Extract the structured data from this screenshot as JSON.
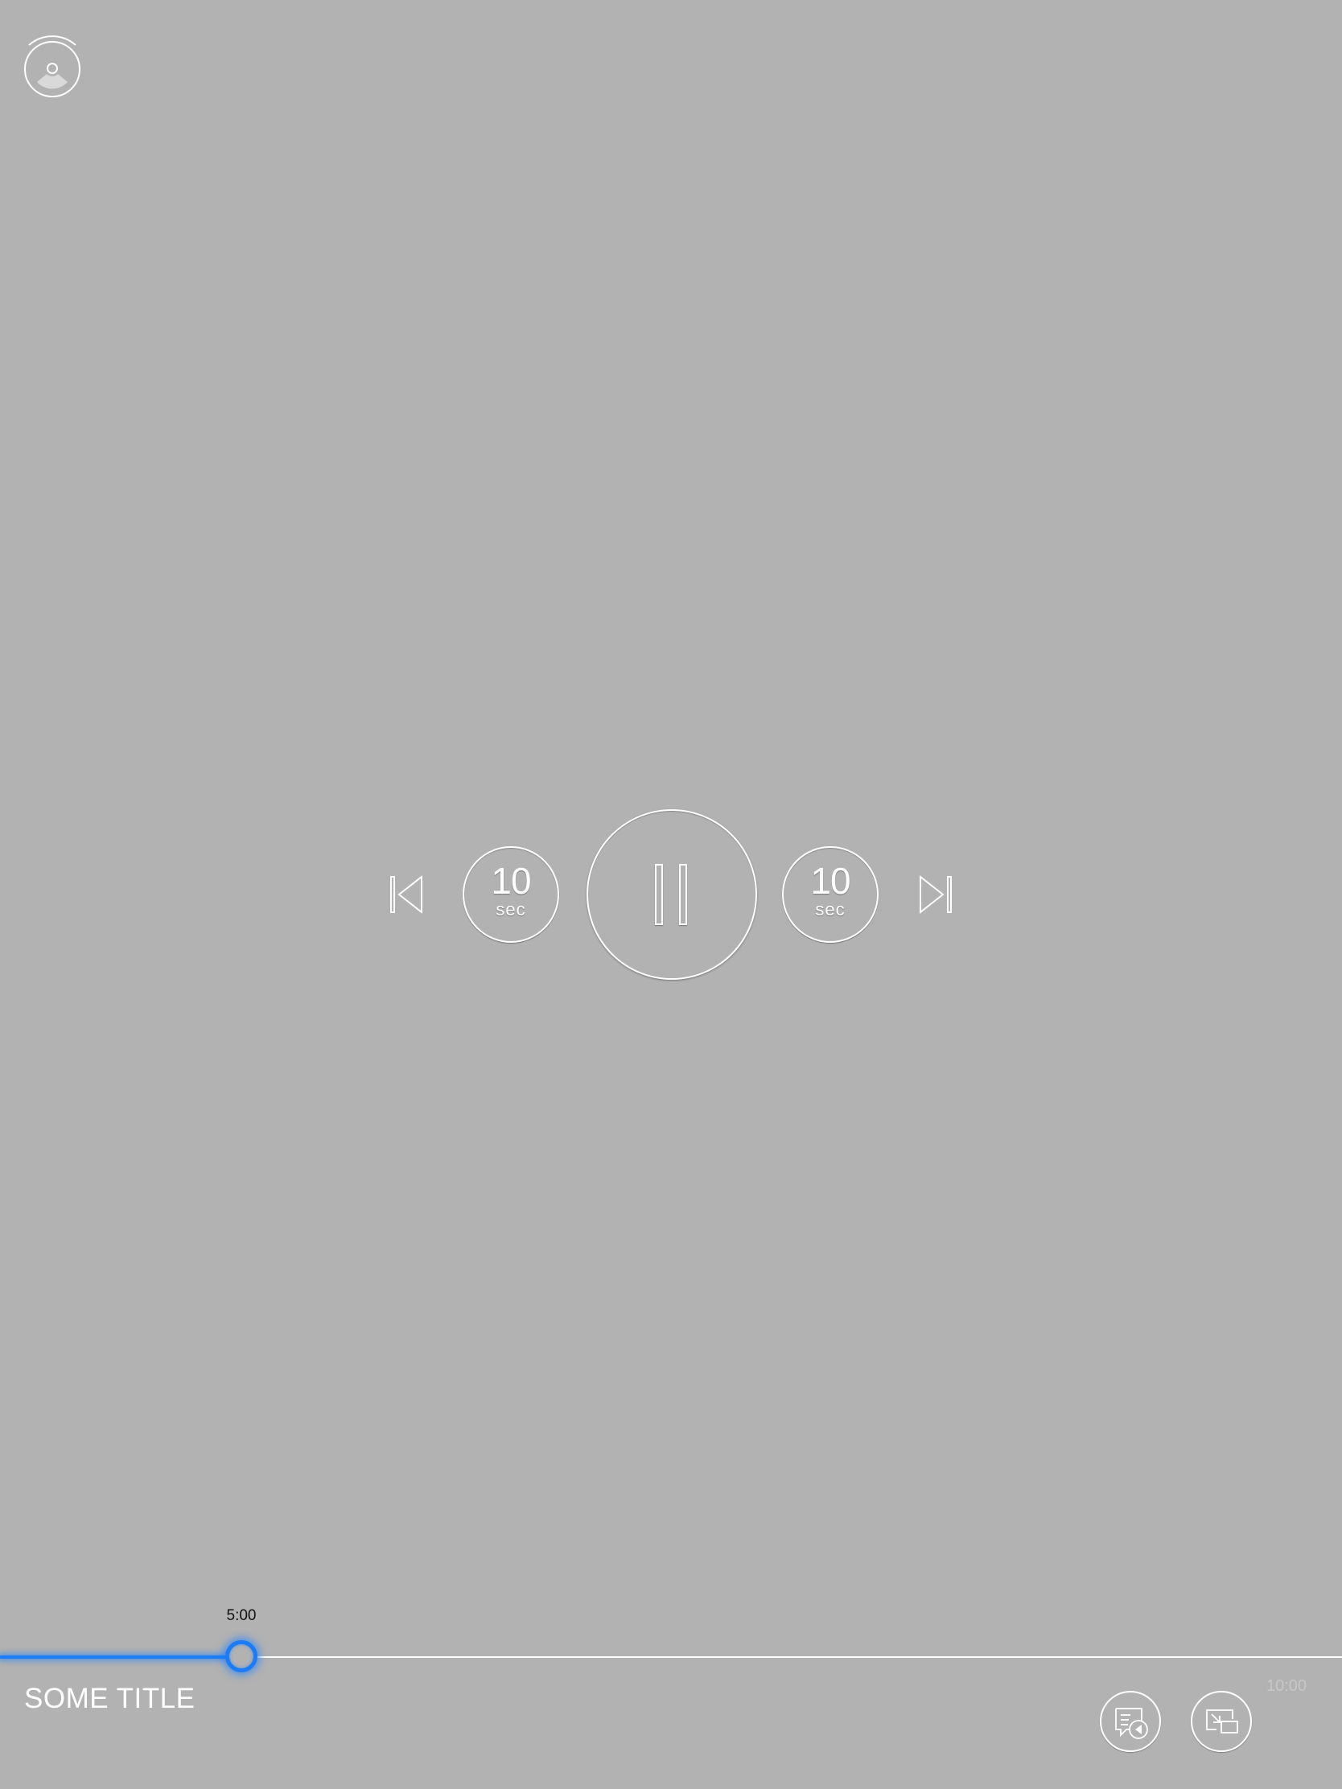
{
  "player": {
    "title": "SOME TITLE",
    "current_time": "5:00",
    "total_time": "10:00",
    "progress": 0.18
  },
  "controls": {
    "skip_back": {
      "amount": "10",
      "unit": "sec"
    },
    "skip_forward": {
      "amount": "10",
      "unit": "sec"
    }
  },
  "icons": {
    "airplay": "airplay-icon",
    "previous": "previous-track-icon",
    "pause": "pause-icon",
    "next": "next-track-icon",
    "audio_subtitles": "audio-subtitles-icon",
    "picture_in_picture": "picture-in-picture-icon"
  },
  "colors": {
    "background": "#b2b2b2",
    "accent": "#1b7cf5",
    "foreground": "#ffffff"
  }
}
